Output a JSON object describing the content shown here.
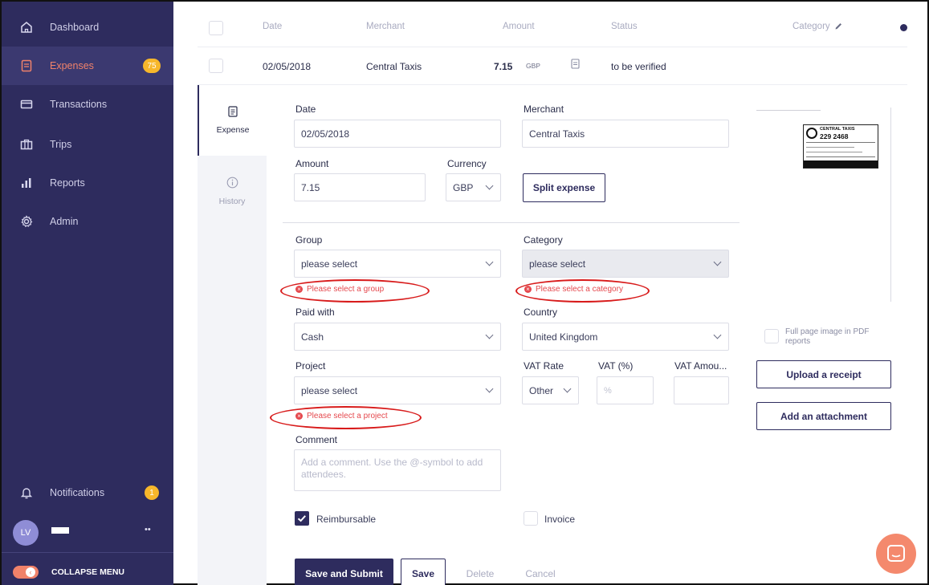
{
  "sidebar": {
    "items": [
      {
        "label": "Dashboard",
        "icon": "home-icon"
      },
      {
        "label": "Expenses",
        "icon": "document-icon",
        "badge": "75"
      },
      {
        "label": "Transactions",
        "icon": "card-icon"
      },
      {
        "label": "Trips",
        "icon": "briefcase-icon"
      },
      {
        "label": "Reports",
        "icon": "bar-chart-icon"
      },
      {
        "label": "Admin",
        "icon": "gear-icon"
      }
    ],
    "notifications": {
      "label": "Notifications",
      "badge": "1"
    },
    "user": {
      "initials": "LV",
      "more": "••"
    },
    "collapse_label": "COLLAPSE MENU"
  },
  "table": {
    "headers": {
      "date": "Date",
      "merchant": "Merchant",
      "amount": "Amount",
      "status": "Status",
      "category": "Category"
    },
    "row": {
      "date": "02/05/2018",
      "merchant": "Central Taxis",
      "amount": "7.15",
      "currency": "GBP",
      "status": "to be verified"
    }
  },
  "tabs": {
    "expense": "Expense",
    "history": "History"
  },
  "form": {
    "date_label": "Date",
    "date_value": "02/05/2018",
    "merchant_label": "Merchant",
    "merchant_value": "Central Taxis",
    "amount_label": "Amount",
    "amount_value": "7.15",
    "currency_label": "Currency",
    "currency_value": "GBP",
    "split_label": "Split expense",
    "group_label": "Group",
    "group_value": "please select",
    "group_error": "Please select a group",
    "category_label": "Category",
    "category_value": "please select",
    "category_error": "Please select a category",
    "paid_label": "Paid with",
    "paid_value": "Cash",
    "country_label": "Country",
    "country_value": "United Kingdom",
    "project_label": "Project",
    "project_value": "please select",
    "project_error": "Please select a project",
    "vat_rate_label": "VAT Rate",
    "vat_rate_value": "Other",
    "vat_pct_label": "VAT (%)",
    "vat_pct_placeholder": "%",
    "vat_amount_label": "VAT Amou...",
    "comment_label": "Comment",
    "comment_placeholder": "Add a comment. Use the @-symbol to add attendees.",
    "reimbursable_label": "Reimbursable",
    "invoice_label": "Invoice"
  },
  "receipt": {
    "full_page_label": "Full page image in PDF reports",
    "upload_label": "Upload a receipt",
    "attach_label": "Add an attachment",
    "line1": "CENTRAL TAXIS",
    "line2": "229 2468"
  },
  "actions": {
    "save_submit": "Save and Submit",
    "save": "Save",
    "delete": "Delete",
    "cancel": "Cancel"
  },
  "colors": {
    "sidebar": "#2e2c5e",
    "accent": "#f0826a",
    "badge": "#f7b72b",
    "error": "#e5484d",
    "annotation": "#d81b1b"
  }
}
